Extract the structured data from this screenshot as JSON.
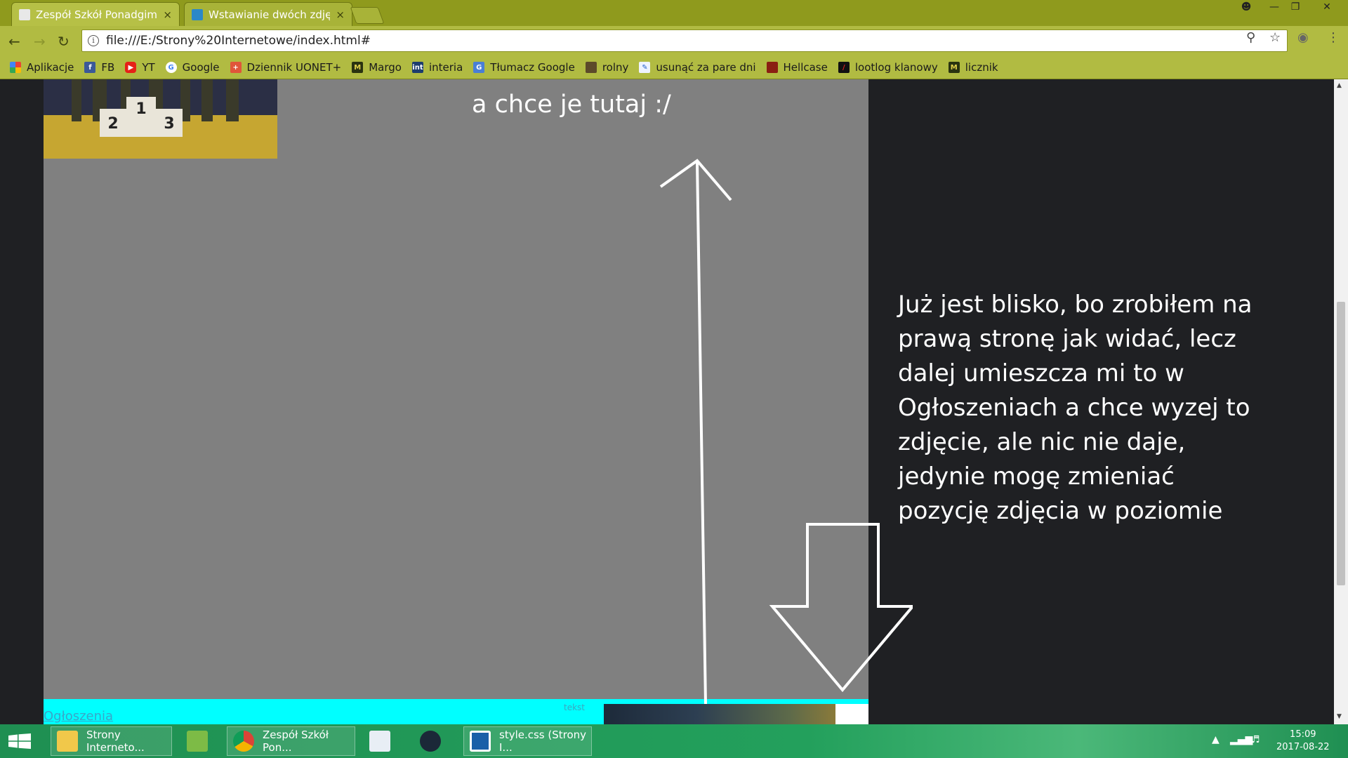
{
  "browser": {
    "tabs": [
      {
        "label": "Zespół Szkół Ponadgimn",
        "active": true
      },
      {
        "label": "Wstawianie dwóch zdjęć",
        "active": false
      }
    ],
    "close_glyph": "×",
    "address": "file:///E:/Strony%20Internetowe/index.html#",
    "bookmarks": [
      {
        "label": "Aplikacje",
        "icon": "apps-grid-icon"
      },
      {
        "label": "FB",
        "icon": "facebook-icon"
      },
      {
        "label": "YT",
        "icon": "youtube-icon"
      },
      {
        "label": "Google",
        "icon": "google-icon"
      },
      {
        "label": "Dziennik UONET+",
        "icon": "uonet-icon"
      },
      {
        "label": "Margo",
        "icon": "margo-icon"
      },
      {
        "label": "interia",
        "icon": "interia-icon"
      },
      {
        "label": "Tłumacz Google",
        "icon": "translate-icon"
      },
      {
        "label": "rolny",
        "icon": "rolny-icon"
      },
      {
        "label": "usunąć za pare dni",
        "icon": "page-icon"
      },
      {
        "label": "Hellcase",
        "icon": "hellcase-icon"
      },
      {
        "label": "lootlog klanowy",
        "icon": "lootlog-icon"
      },
      {
        "label": "licznik",
        "icon": "margo-icon"
      }
    ]
  },
  "page": {
    "note_top": "a chce je tutaj :/",
    "note_right": "Już jest blisko, bo zrobiłem na prawą stronę jak widać, lecz dalej umieszcza mi to w Ogłoszeniach a chce wyzej to zdjęcie, ale nic nie daje, jedynie mogę zmieniać pozycję zdjęcia w poziomie",
    "section_link": "Ogłoszenia",
    "small_text": "tekst",
    "podium": [
      "2",
      "1",
      "3"
    ]
  },
  "taskbar": {
    "items": [
      {
        "label": "Strony Interneto...",
        "icon": "folder-icon"
      },
      {
        "label": "",
        "icon": "notepad-icon"
      },
      {
        "label": "Zespół Szkół Pon...",
        "icon": "chrome-icon"
      },
      {
        "label": "",
        "icon": "document-icon"
      },
      {
        "label": "",
        "icon": "steam-icon"
      },
      {
        "label": "style.css (Strony I...",
        "icon": "brackets-icon"
      }
    ],
    "time": "15:09",
    "date": "2017-08-22"
  },
  "colors": {
    "chrome_theme": "#b1bb42",
    "page_gray": "#808080",
    "page_dark": "#1f2023",
    "cyan": "#00ffff",
    "taskbar": "#23a05c"
  }
}
